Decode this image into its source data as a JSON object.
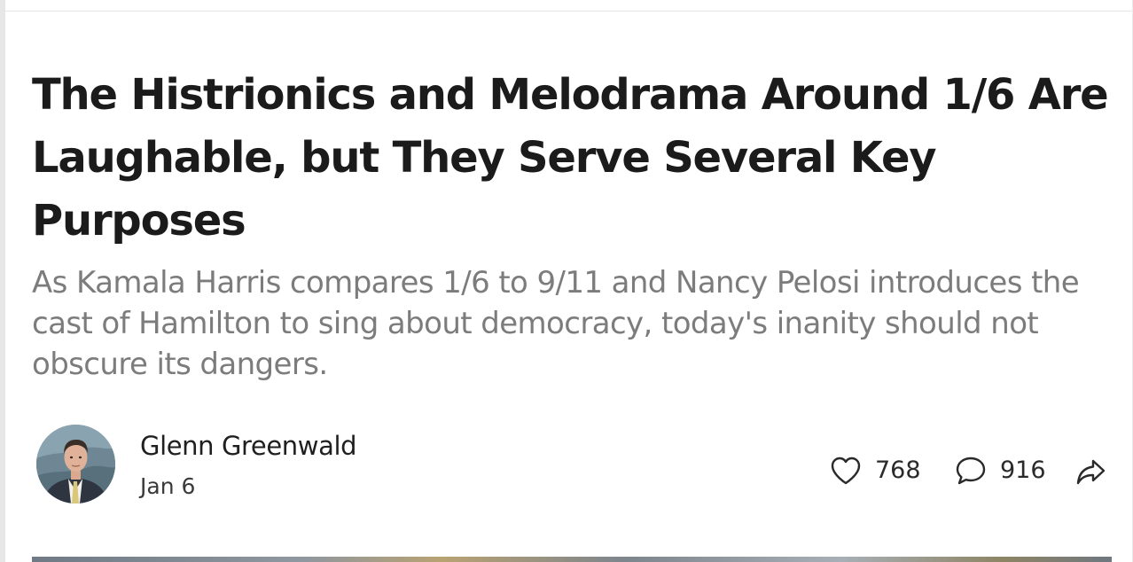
{
  "post": {
    "title": "The Histrionics and Melodrama Around 1/6 Are Laughable, but They Serve Several Key Purposes",
    "subtitle": "As Kamala Harris compares 1/6 to 9/11 and Nancy Pelosi introduces the cast of Hamilton to sing about democracy, today's inanity should not obscure its dangers.",
    "author": "Glenn Greenwald",
    "date": "Jan 6"
  },
  "actions": {
    "likes": "768",
    "comments": "916"
  },
  "icons": {
    "like": "heart-icon",
    "comment": "comment-bubble-icon",
    "share": "share-arrow-icon"
  },
  "colors": {
    "title": "#1b1b1b",
    "subtitle": "#7c7c7c",
    "text": "#2a2a2a"
  }
}
